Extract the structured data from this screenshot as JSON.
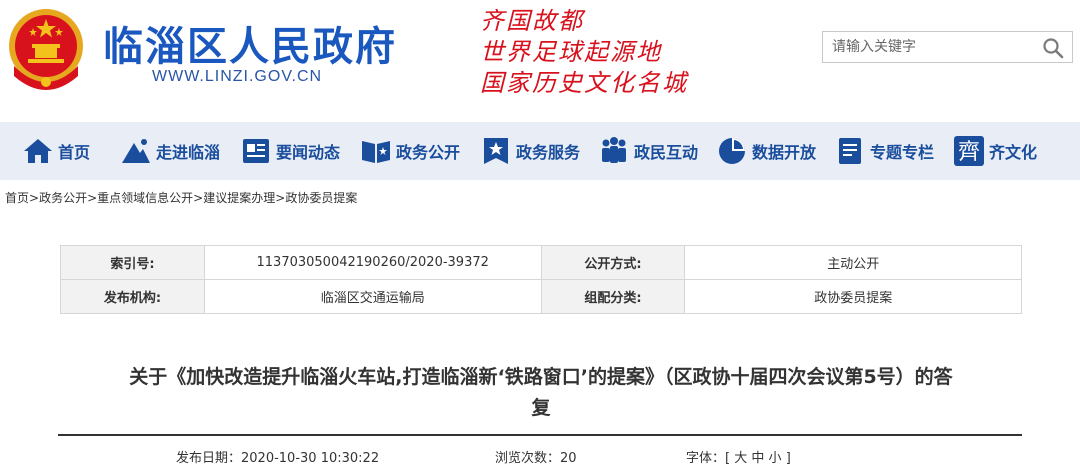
{
  "header": {
    "site_title": "临淄区人民政府",
    "site_url": "WWW.LINZI.GOV.CN",
    "slogans": [
      "齐国故都",
      "世界足球起源地",
      "国家历史文化名城"
    ],
    "search_placeholder": "请输入关键字",
    "colors": {
      "title": "#1a58c0",
      "slogan": "#d8121d",
      "nav_bg": "#e8edf6",
      "nav_text": "#1a4d9c"
    }
  },
  "nav": {
    "items": [
      {
        "label": "首页",
        "icon": "home-icon"
      },
      {
        "label": "走进临淄",
        "icon": "mountain-icon"
      },
      {
        "label": "要闻动态",
        "icon": "news-icon"
      },
      {
        "label": "政务公开",
        "icon": "open-book-icon"
      },
      {
        "label": "政务服务",
        "icon": "service-star-icon"
      },
      {
        "label": "政民互动",
        "icon": "people-icon"
      },
      {
        "label": "数据开放",
        "icon": "pie-chart-icon"
      },
      {
        "label": "专题专栏",
        "icon": "document-icon"
      },
      {
        "label": "齐文化",
        "icon": "qi-character-icon"
      }
    ]
  },
  "breadcrumb": [
    "首页",
    "政务公开",
    "重点领域信息公开",
    "建议提案办理",
    "政协委员提案"
  ],
  "info": {
    "index_label": "索引号:",
    "index_value": "11370305004219026​0/2020-39372",
    "method_label": "公开方式:",
    "method_value": "主动公开",
    "org_label": "发布机构:",
    "org_value": "临淄区交通运输局",
    "category_label": "组配分类:",
    "category_value": "政协委员提案"
  },
  "article": {
    "title_line1": "关于《加快改造提升临淄火车站,打造临淄新‘铁路窗口’的提案》（区政协十届四次会议第5号）的答",
    "title_line2": "复",
    "publish_label": "发布日期：",
    "publish_date": "2020-10-30 10:30:22",
    "views_label": "浏览次数：",
    "views": "20",
    "font_label": "字体：",
    "font_open": "[",
    "font_large": "大",
    "font_medium": "中",
    "font_small": "小",
    "font_close": "]"
  }
}
